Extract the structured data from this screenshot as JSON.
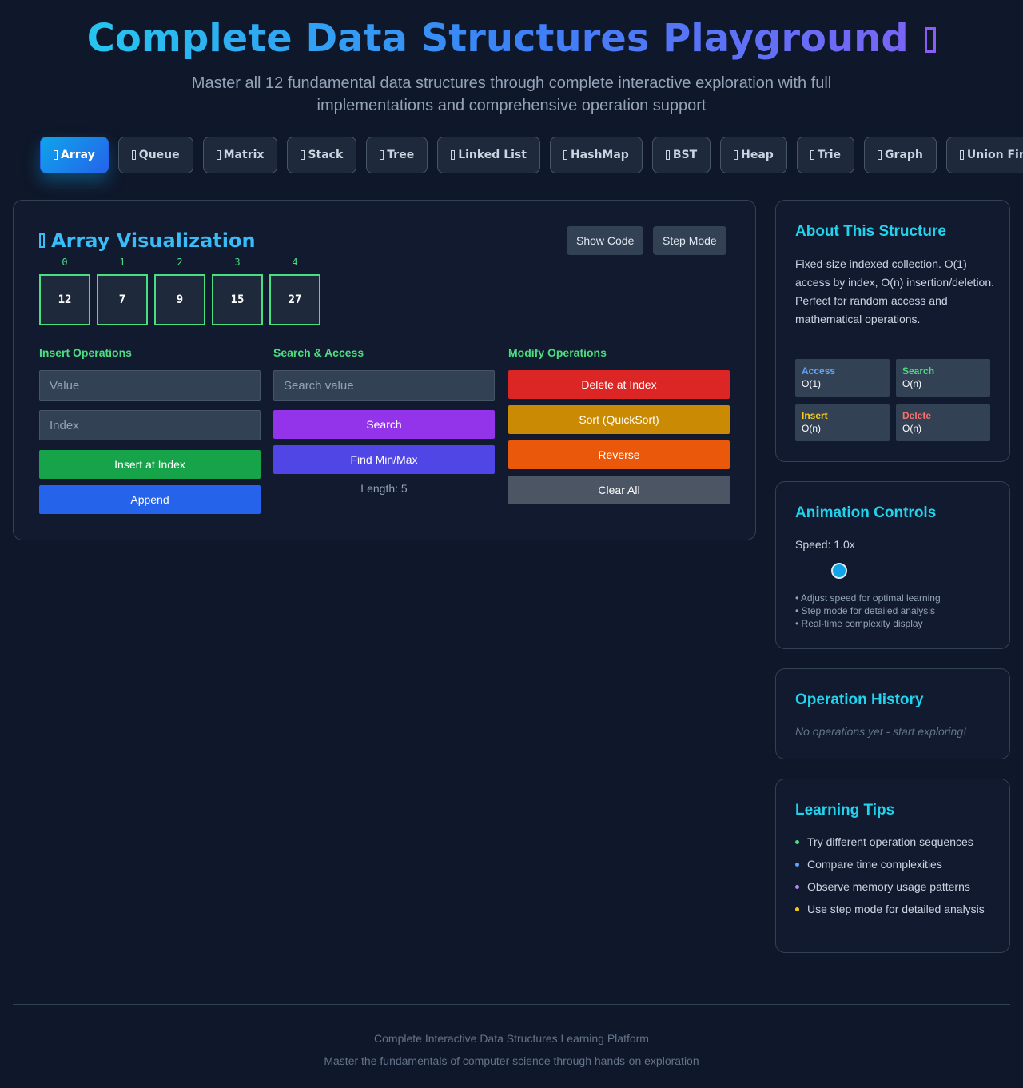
{
  "header": {
    "title": "Complete Data Structures Playground",
    "subtitle": "Master all 12 fundamental data structures through complete interactive exploration with full implementations and comprehensive operation support"
  },
  "tabs": [
    {
      "label": "Array",
      "active": true
    },
    {
      "label": "Queue"
    },
    {
      "label": "Matrix"
    },
    {
      "label": "Stack"
    },
    {
      "label": "Tree"
    },
    {
      "label": "Linked List"
    },
    {
      "label": "HashMap"
    },
    {
      "label": "BST"
    },
    {
      "label": "Heap"
    },
    {
      "label": "Trie"
    },
    {
      "label": "Graph"
    },
    {
      "label": "Union Find"
    }
  ],
  "visualization": {
    "title": "Array Visualization",
    "show_code_label": "Show Code",
    "step_mode_label": "Step Mode",
    "cells": [
      {
        "index": "0",
        "value": "12"
      },
      {
        "index": "1",
        "value": "7"
      },
      {
        "index": "2",
        "value": "9"
      },
      {
        "index": "3",
        "value": "15"
      },
      {
        "index": "4",
        "value": "27"
      }
    ]
  },
  "insert_ops": {
    "heading": "Insert Operations",
    "value_placeholder": "Value",
    "index_placeholder": "Index",
    "insert_at_index_label": "Insert at Index",
    "append_label": "Append"
  },
  "search_ops": {
    "heading": "Search & Access",
    "search_placeholder": "Search value",
    "search_label": "Search",
    "find_minmax_label": "Find Min/Max",
    "length_text": "Length: 5"
  },
  "modify_ops": {
    "heading": "Modify Operations",
    "delete_label": "Delete at Index",
    "sort_label": "Sort (QuickSort)",
    "reverse_label": "Reverse",
    "clear_label": "Clear All"
  },
  "about": {
    "title": "About This Structure",
    "description": "Fixed-size indexed collection. O(1) access by index, O(n) insertion/deletion. Perfect for random access and mathematical operations.",
    "complexity": [
      {
        "name": "Access",
        "value": "O(1)",
        "color": "#60a5fa"
      },
      {
        "name": "Search",
        "value": "O(n)",
        "color": "#4ade80"
      },
      {
        "name": "Insert",
        "value": "O(n)",
        "color": "#facc15"
      },
      {
        "name": "Delete",
        "value": "O(n)",
        "color": "#f87171"
      }
    ]
  },
  "animation": {
    "title": "Animation Controls",
    "speed_label": "Speed: 1.0x",
    "speed_value": 1.0,
    "tips": [
      "• Adjust speed for optimal learning",
      "• Step mode for detailed analysis",
      "• Real-time complexity display"
    ]
  },
  "history": {
    "title": "Operation History",
    "empty_text": "No operations yet - start exploring!"
  },
  "learning_tips": {
    "title": "Learning Tips",
    "items": [
      {
        "text": "Try different operation sequences",
        "color": "#4ade80"
      },
      {
        "text": "Compare time complexities",
        "color": "#60a5fa"
      },
      {
        "text": "Observe memory usage patterns",
        "color": "#c084fc"
      },
      {
        "text": "Use step mode for detailed analysis",
        "color": "#facc15"
      }
    ]
  },
  "footer": {
    "line1": "Complete Interactive Data Structures Learning Platform",
    "line2": "Master the fundamentals of computer science through hands-on exploration"
  },
  "colors": {
    "insert_at_index": "#16a34a",
    "append": "#2563eb",
    "search": "#9333ea",
    "find_minmax": "#4f46e5",
    "delete": "#dc2626",
    "sort": "#ca8a04",
    "reverse": "#ea580c",
    "clear": "#4b5563"
  }
}
